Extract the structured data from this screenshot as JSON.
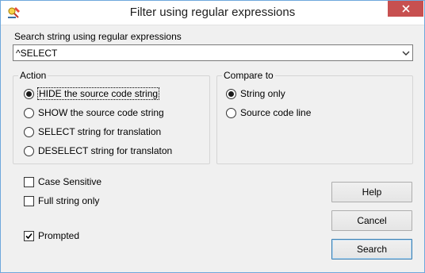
{
  "window": {
    "title": "Filter using regular expressions"
  },
  "search": {
    "label": "Search string using regular expressions",
    "value": "^SELECT"
  },
  "action": {
    "title": "Action",
    "options": [
      {
        "label": "HIDE the source code string",
        "checked": true
      },
      {
        "label": "SHOW the source code string",
        "checked": false
      },
      {
        "label": "SELECT string for translation",
        "checked": false
      },
      {
        "label": "DESELECT string for translaton",
        "checked": false
      }
    ]
  },
  "compare": {
    "title": "Compare to",
    "options": [
      {
        "label": "String only",
        "checked": true
      },
      {
        "label": "Source code line",
        "checked": false
      }
    ]
  },
  "checks": {
    "case_sensitive": {
      "label": "Case Sensitive",
      "checked": false
    },
    "full_string": {
      "label": "Full string only",
      "checked": false
    },
    "prompted": {
      "label": "Prompted",
      "checked": true
    }
  },
  "buttons": {
    "help": "Help",
    "cancel": "Cancel",
    "search": "Search"
  },
  "colors": {
    "close_button": "#c75050",
    "window_border": "#6fa8dc",
    "default_button_border": "#3c7fb1"
  },
  "icons": {
    "app": "magnifier-pencil-icon",
    "close": "close-icon",
    "dropdown": "chevron-down-icon",
    "check": "checkmark-icon"
  }
}
